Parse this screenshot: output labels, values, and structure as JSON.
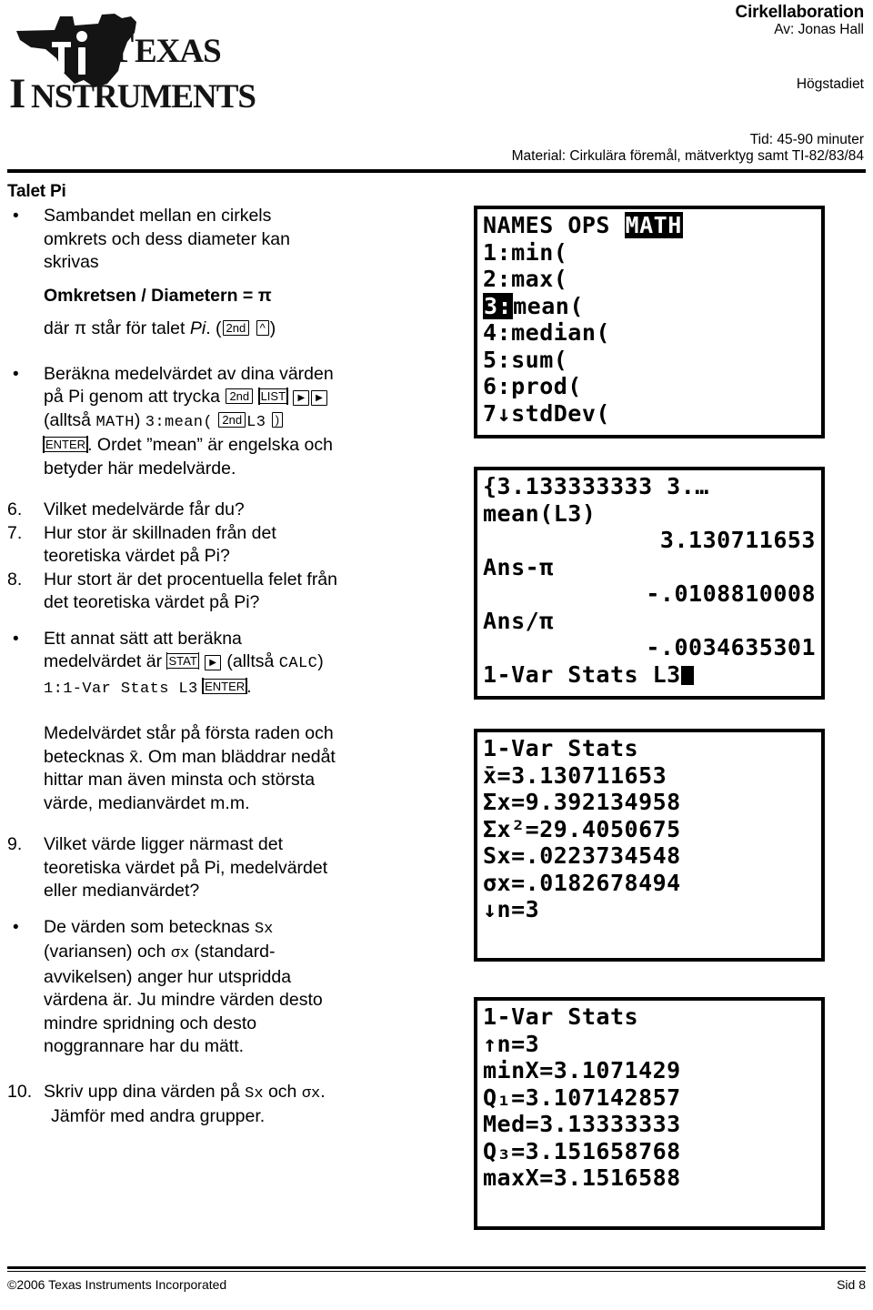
{
  "header": {
    "logo_alt": "Texas Instruments",
    "logo_line1": "TEXAS",
    "logo_line2": "INSTRUMENTS",
    "title": "Cirkellaboration",
    "author": "Av: Jonas Hall",
    "level": "Högstadiet",
    "time": "Tid: 45-90 minuter",
    "material": "Material: Cirkulära föremål, mätverktyg samt TI-82/83/84"
  },
  "content": {
    "section_title": "Talet Pi",
    "b1_l1": "Sambandet mellan en cirkels",
    "b1_l2": "omkrets och dess diameter kan",
    "b1_l3": "skrivas",
    "formula": "Omkretsen / Diametern = π",
    "where_pre": "där  π  står för talet ",
    "where_italic": "Pi",
    "where_post": ". (",
    "key_2nd": "2nd",
    "key_caret": "^",
    "where_close": ")",
    "b2_l1": "Beräkna medelvärdet av dina värden",
    "b2_l2_pre": "på Pi genom att trycka ",
    "key_list": "LIST",
    "key_right": "▶",
    "b2_l3_pre": "(alltså ",
    "b2_l3_math": "MATH",
    "b2_l3_mid": ") ",
    "b2_l3_mean": "3:mean(",
    "b2_l3_l3": "L3",
    "b2_l3_paren": ")",
    "key_enter": "ENTER",
    "b2_l4_post": ". Ordet ”mean” är engelska och",
    "b2_l5": "betyder här medelvärde.",
    "q6_num": "6.",
    "q6_text": "Vilket medelvärde får du?",
    "q7_num": "7.",
    "q7_l1": "Hur stor är skillnaden från det",
    "q7_l2": "teoretiska värdet på Pi?",
    "q8_num": "8.",
    "q8_l1": "Hur stort är det procentuella felet från",
    "q8_l2": "det teoretiska värdet på Pi?",
    "b3_l1": "Ett annat sätt att beräkna",
    "b3_l2_pre": "medelvärdet är ",
    "key_stat": "STAT",
    "b3_l2_mid": " (alltså ",
    "b3_l2_calc": "CALC",
    "b3_l2_post": ")",
    "b3_l3_cmd": "1:1-Var Stats L3",
    "b3_l3_post": ".",
    "b4_l1": "Medelvärdet står på första raden och",
    "b4_l2": "betecknas x̄. Om man bläddrar nedåt",
    "b4_l3": "hittar man även minsta och största",
    "b4_l4": "värde, medianvärdet m.m.",
    "q9_num": "9.",
    "q9_l1": "Vilket värde ligger närmast det",
    "q9_l2": "teoretiska värdet på Pi, medelvärdet",
    "q9_l3": "eller medianvärdet?",
    "b5_l1_pre": "De värden som betecknas ",
    "b5_l1_sx": "Sx",
    "b5_l2_pre": "(variansen) och ",
    "b5_l2_sigx": "σx",
    "b5_l2_post": " (standard-",
    "b5_l3": "avvikelsen) anger hur utspridda",
    "b5_l4": "värdena är. Ju mindre värden desto",
    "b5_l5": "mindre spridning och desto",
    "b5_l6": "noggrannare har du mätt.",
    "q10_num": "10.",
    "q10_l1_pre": "Skriv upp dina värden på ",
    "q10_l1_sx": "Sx",
    "q10_l1_mid": " och ",
    "q10_l1_sigx": "σx",
    "q10_l1_post": ".",
    "q10_l2": "Jämför med andra grupper."
  },
  "screens": {
    "screen1": {
      "name": "list-math-menu",
      "tabs": [
        "NAMES",
        "OPS",
        "MATH"
      ],
      "selected_tab": "MATH",
      "items": [
        {
          "label": "1:min(",
          "highlighted": false
        },
        {
          "label": "2:max(",
          "highlighted": false
        },
        {
          "label": "3:mean(",
          "highlighted": true,
          "highlight_part": "3:"
        },
        {
          "label": "4:median(",
          "highlighted": false
        },
        {
          "label": "5:sum(",
          "highlighted": false
        },
        {
          "label": "6:prod(",
          "highlighted": false
        },
        {
          "label": "7↓stdDev(",
          "highlighted": false
        }
      ]
    },
    "screen2": {
      "name": "home-screen-mean",
      "lines": [
        "{3.133333333 3.…",
        "mean(L3)",
        "3.130711653",
        "Ans-π",
        "-.0108810008",
        "Ans/π",
        "-.0034635301",
        "1-Var Stats L3"
      ]
    },
    "screen3": {
      "name": "one-var-stats-page1",
      "title": "1-Var Stats",
      "rows": [
        "x̄=3.130711653",
        "Σx=9.392134958",
        "Σx²=29.4050675",
        "Sx=.0223734548",
        "σx=.0182678494",
        "↓n=3"
      ]
    },
    "screen4": {
      "name": "one-var-stats-page2",
      "title": "1-Var Stats",
      "rows": [
        "↑n=3",
        "minX=3.1071429",
        "Q₁=3.107142857",
        "Med=3.13333333",
        "Q₃=3.151658768",
        "maxX=3.1516588"
      ]
    }
  },
  "footer": {
    "copyright": "©2006 Texas Instruments Incorporated",
    "page": "Sid 8"
  }
}
